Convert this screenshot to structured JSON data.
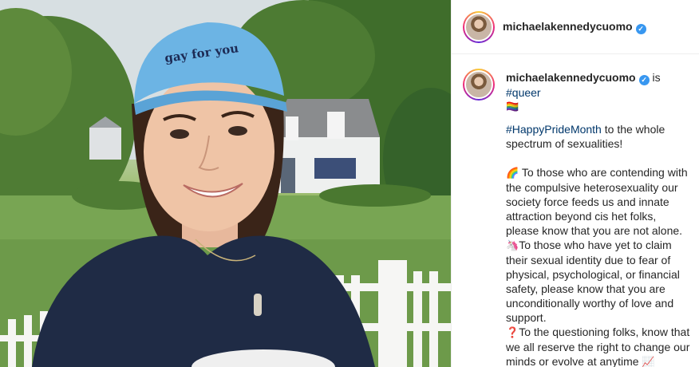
{
  "post": {
    "username": "michaelakennedycuomo",
    "verified_mark": "✓",
    "caption_intro_prefix": "is",
    "caption_intro_tag": "#queer",
    "caption_intro_emoji": "🏳️‍🌈",
    "hashtag_pride": "#HappyPrideMonth",
    "pride_line": "to the whole spectrum of sexualities!",
    "para1_emoji": "🌈",
    "para1": "To those who are contending with the compulsive heterosexuality our society force feeds us and innate attraction beyond cis het folks, please know that you are not alone.",
    "para2_emoji": "🦄",
    "para2": "To those who have yet to claim their sexual identity due to fear of physical, psychological, or financial safety, please know that you are unconditionally worthy of love and support.",
    "para3_emoji": "❓",
    "para3": "To the questioning folks, know that we all reserve the right to change our minds or evolve at anytime",
    "para3_end_emoji": "📈",
    "hat_text": "gay for you"
  },
  "colors": {
    "hat": "#6cb4e4",
    "sweater": "#1f2b45",
    "link": "#00376b",
    "verified": "#3897f0"
  }
}
